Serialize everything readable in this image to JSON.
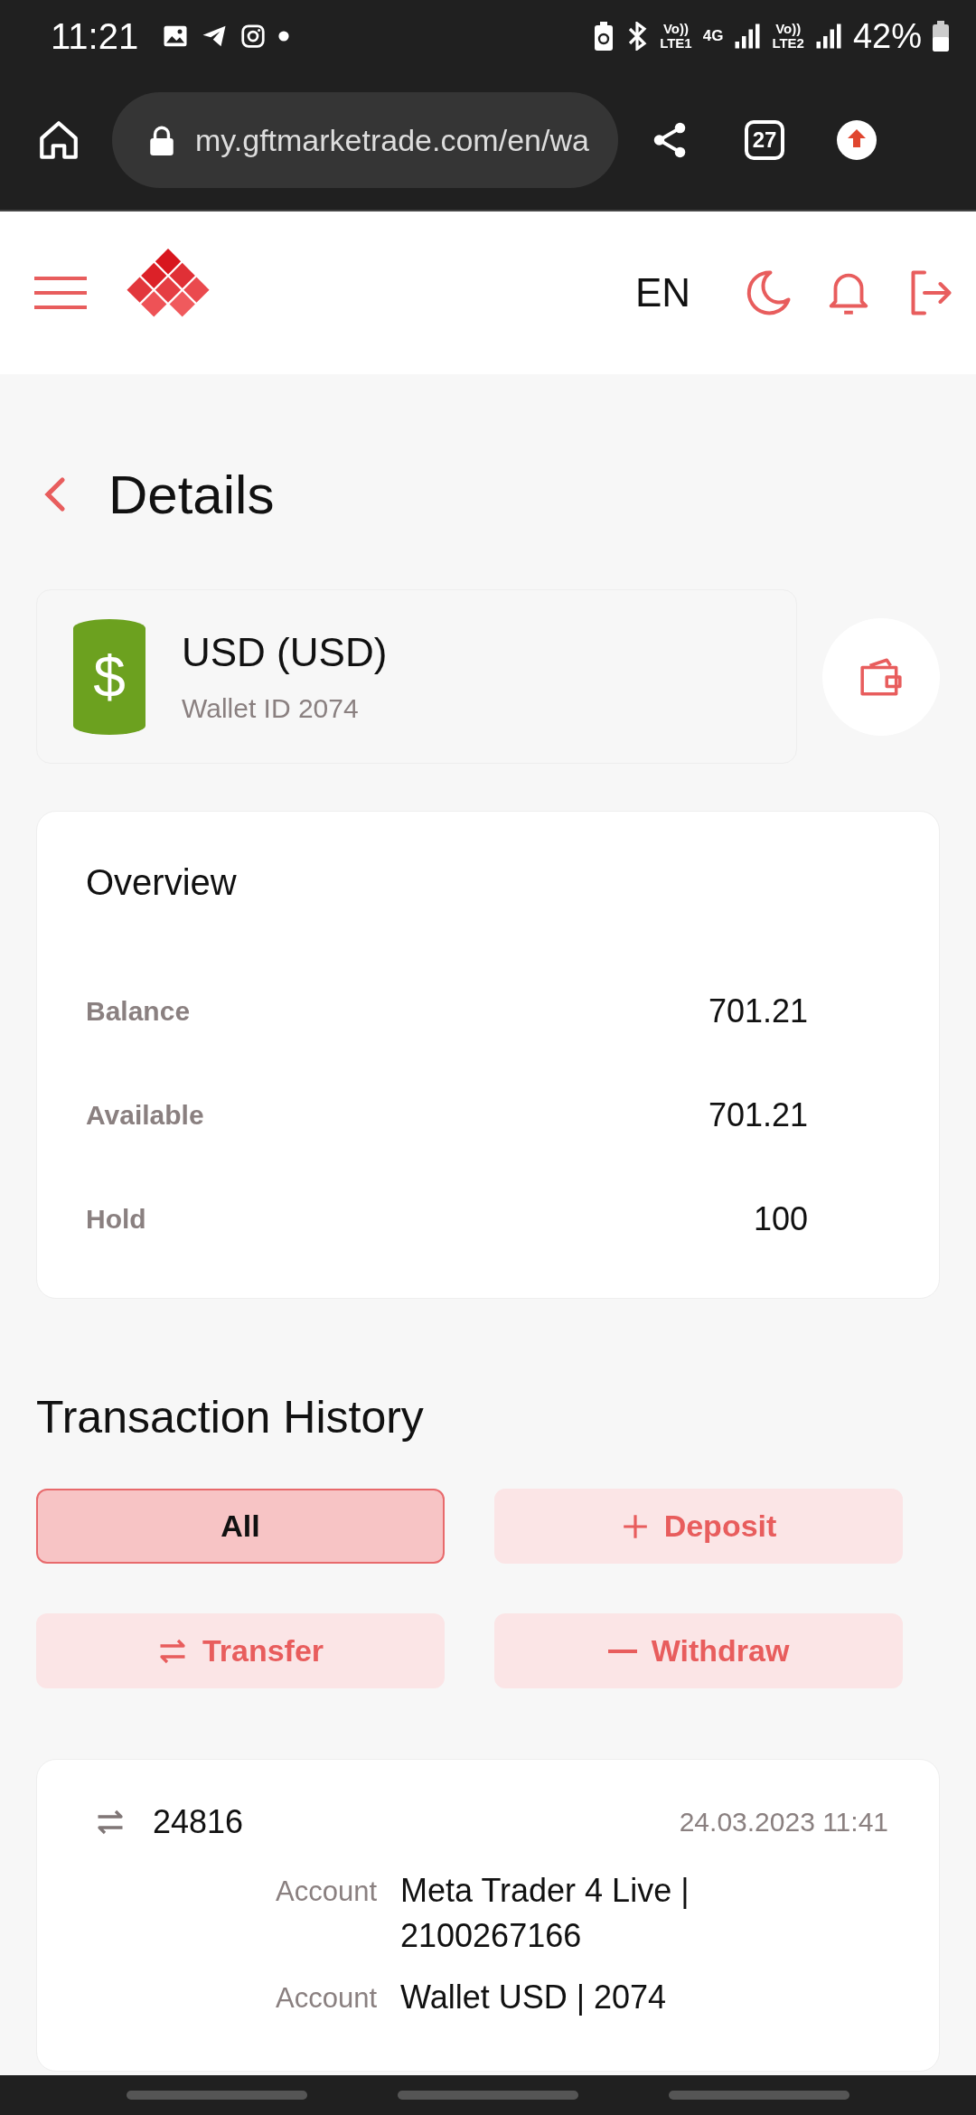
{
  "status_bar": {
    "time": "11:21",
    "network_1": "Vo))\nLTE1",
    "network_2": "4G",
    "network_3": "Vo))\nLTE2",
    "battery": "42%"
  },
  "browser": {
    "url": "my.gftmarketrade.com/en/wa",
    "tab_count": "27"
  },
  "header": {
    "language": "EN"
  },
  "page": {
    "title": "Details"
  },
  "wallet": {
    "name": "USD (USD)",
    "wallet_id": "Wallet ID 2074",
    "currency_symbol": "$"
  },
  "overview": {
    "title": "Overview",
    "rows": [
      {
        "label": "Balance",
        "value": "701.21"
      },
      {
        "label": "Available",
        "value": "701.21"
      },
      {
        "label": "Hold",
        "value": "100"
      }
    ]
  },
  "history": {
    "title": "Transaction History",
    "filters": [
      {
        "label": "All",
        "selected": true,
        "kind": "none"
      },
      {
        "label": "Deposit",
        "selected": false,
        "kind": "plus"
      },
      {
        "label": "Transfer",
        "selected": false,
        "kind": "arrows"
      },
      {
        "label": "Withdraw",
        "selected": false,
        "kind": "minus"
      }
    ],
    "transactions": [
      {
        "id": "24816",
        "date": "24.03.2023 11:41",
        "fields": [
          {
            "label": "Account",
            "value": "Meta Trader 4 Live | 2100267166"
          },
          {
            "label": "Account",
            "value": "Wallet USD | 2074"
          }
        ]
      }
    ]
  }
}
